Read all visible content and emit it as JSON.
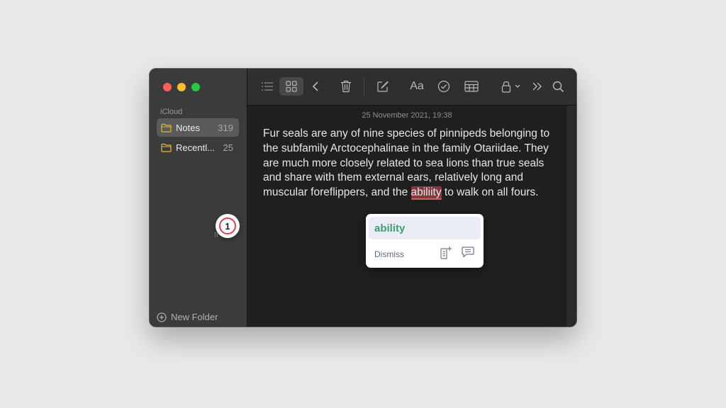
{
  "sidebar": {
    "section_label": "iCloud",
    "folders": [
      {
        "name": "Notes",
        "count": "319",
        "selected": true
      },
      {
        "name": "Recentl...",
        "count": "25",
        "selected": false
      }
    ],
    "new_folder_label": "New Folder"
  },
  "toolbar": {
    "icons": [
      "list-view-icon",
      "gallery-view-icon",
      "back-icon",
      "trash-icon",
      "compose-icon",
      "format-text-icon",
      "checklist-icon",
      "table-icon",
      "lock-icon",
      "more-icon",
      "search-icon"
    ],
    "format_label": "Aa"
  },
  "note": {
    "date": "25 November 2021, 19:38",
    "text_before": "Fur seals are any of nine species of pinnipeds belonging to the subfamily Arctocephalinae in the family Otariidae. They are much more closely related to sea lions than true seals and share with them external ears, relatively long and muscular foreflippers, and the ",
    "misspelled_word": "abiliity",
    "text_after": " to walk on all fours."
  },
  "popup": {
    "suggestion": "ability",
    "dismiss_label": "Dismiss",
    "icons": [
      "add-to-dictionary-icon",
      "feedback-icon"
    ],
    "accent_color": "#3f9d74"
  },
  "badge": {
    "count": "1"
  },
  "colors": {
    "sidebar_bg": "#3b3b3b",
    "toolbar_bg": "#2f2f2f",
    "content_bg": "#1f1f1f",
    "misspelling_highlight": "#d55a66"
  }
}
